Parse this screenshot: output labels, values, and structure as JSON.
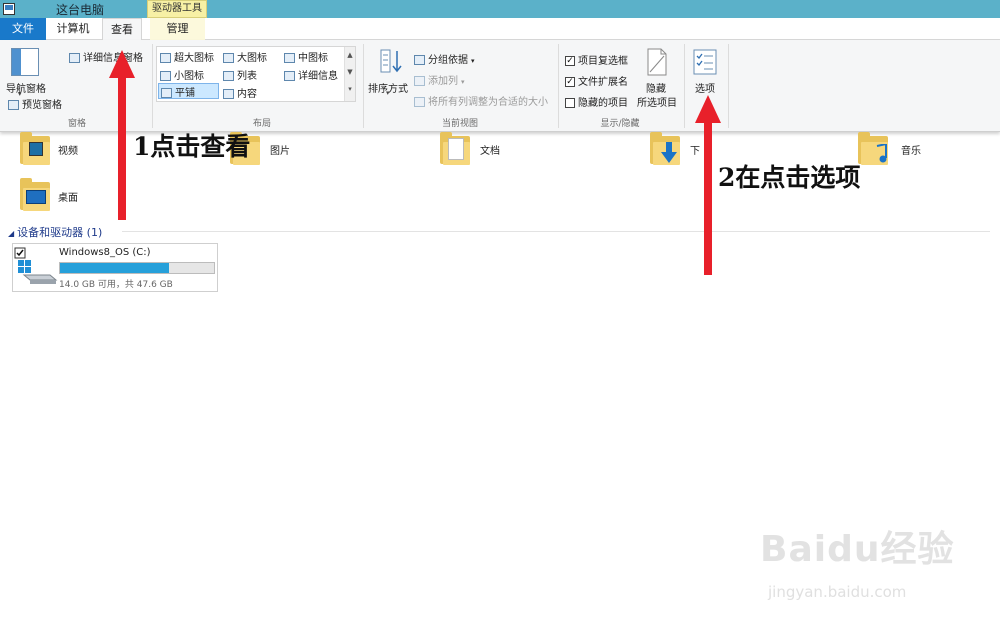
{
  "window": {
    "title": "这台电脑",
    "context_tool": "驱动器工具"
  },
  "tabs": [
    {
      "label": "文件"
    },
    {
      "label": "计算机"
    },
    {
      "label": "查看"
    },
    {
      "label": "管理"
    }
  ],
  "ribbon": {
    "panes": {
      "nav_pane": "导航窗格",
      "details_pane": "详细信息窗格",
      "preview_pane": "预览窗格",
      "group": "窗格"
    },
    "layout": {
      "items": [
        "超大图标",
        "大图标",
        "中图标",
        "小图标",
        "列表",
        "详细信息",
        "平铺",
        "内容"
      ],
      "selected": "平铺",
      "group": "布局"
    },
    "current_view": {
      "sort_by": "排序方式",
      "group_by": "分组依据",
      "add_column": "添加列",
      "fit_columns": "将所有列调整为合适的大小",
      "group": "当前视图"
    },
    "show_hide": {
      "item_checkboxes": "项目复选框",
      "file_extensions": "文件扩展名",
      "hidden_items": "隐藏的项目",
      "item_checkboxes_checked": true,
      "file_extensions_checked": true,
      "hidden_items_checked": false,
      "hide_selected_line1": "隐藏",
      "hide_selected_line2": "所选项目",
      "group": "显示/隐藏"
    },
    "options": "选项"
  },
  "folders": [
    {
      "label": "视频",
      "icon": "video-folder-icon"
    },
    {
      "label": "图片",
      "icon": "pictures-folder-icon"
    },
    {
      "label": "文档",
      "icon": "documents-folder-icon"
    },
    {
      "label": "下",
      "icon": "downloads-folder-icon"
    },
    {
      "label": "音乐",
      "icon": "music-folder-icon"
    },
    {
      "label": "桌面",
      "icon": "desktop-folder-icon"
    }
  ],
  "devices": {
    "header": "设备和驱动器 (1)",
    "drive": {
      "name": "Windows8_OS (C:)",
      "free_text": "14.0 GB 可用，共 47.6 GB",
      "used_fraction": 0.706,
      "checked": true
    }
  },
  "annotations": {
    "step1": "1点击查看",
    "step2": "2在点击选项",
    "arrow_color": "#e8202a"
  },
  "watermark": {
    "logo": "Baidu经验",
    "url": "jingyan.baidu.com"
  }
}
